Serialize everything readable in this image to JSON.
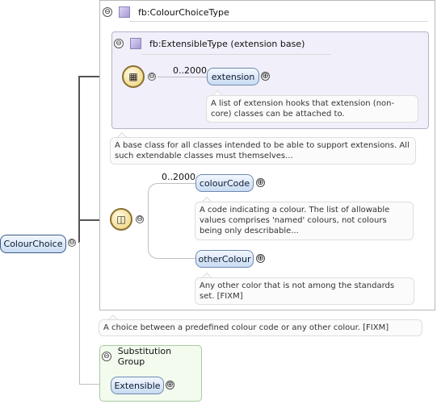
{
  "root_element": {
    "label": "ColourChoice"
  },
  "type": {
    "name": "fb:ColourChoiceType",
    "documentation": "A choice between a predefined colour code or any other colour. [FIXM]",
    "extension_base": {
      "name": "fb:ExtensibleType (extension base)",
      "documentation": "A base class for all classes intended to be able to support extensions. All such extendable classes must themselves...",
      "sequence": {
        "occurs": "0..2000",
        "element": {
          "label": "extension",
          "documentation": "A list of extension hooks that extension (non-core) classes can be attached to."
        }
      }
    },
    "choice": {
      "occurs": "0..2000",
      "elements": [
        {
          "label": "colourCode",
          "documentation": "A code indicating a colour. The list of allowable values comprises 'named' colours, not colours being only describable..."
        },
        {
          "label": "otherColour",
          "documentation": "Any other color that is not among the standards set. [FIXM]"
        }
      ]
    }
  },
  "substitution_group": {
    "title": "Substitution Group",
    "element": {
      "label": "Extensible"
    }
  },
  "icons": {
    "collapse": "⊖",
    "expand": "⊕",
    "type_icon": "purple-square-icon",
    "sequence_icon": "sequence-compositor-icon",
    "choice_icon": "choice-compositor-icon"
  },
  "colors": {
    "element_fill": "#c9dcf2",
    "extension_fill": "#f1effa",
    "substitution_fill": "#f2fbee",
    "compositor_fill": "#f3dc95"
  }
}
